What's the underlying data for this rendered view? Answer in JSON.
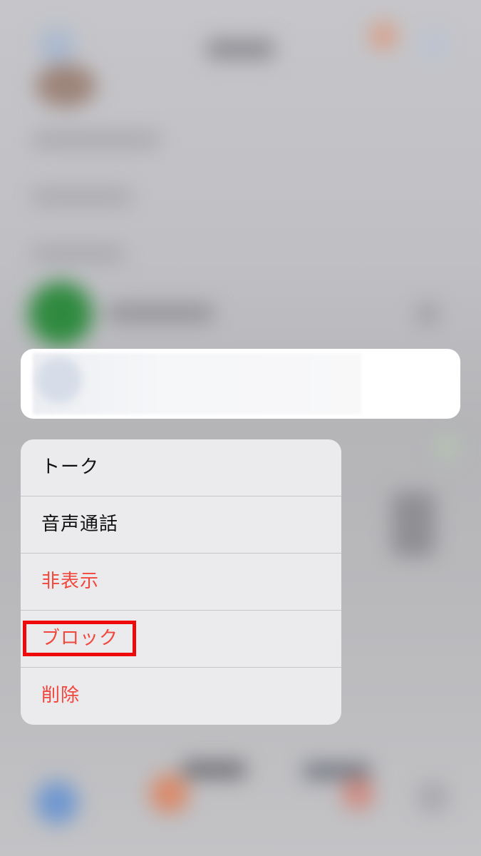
{
  "context_menu": {
    "items": [
      {
        "label": "トーク",
        "style": "normal"
      },
      {
        "label": "音声通話",
        "style": "normal"
      },
      {
        "label": "非表示",
        "style": "destructive"
      },
      {
        "label": "ブロック",
        "style": "destructive",
        "highlighted": true
      },
      {
        "label": "削除",
        "style": "destructive"
      }
    ]
  },
  "colors": {
    "destructive": "#f0463c",
    "highlight": "#ee0a0a",
    "menu_background": "#ececee",
    "card_background": "#ffffff"
  }
}
